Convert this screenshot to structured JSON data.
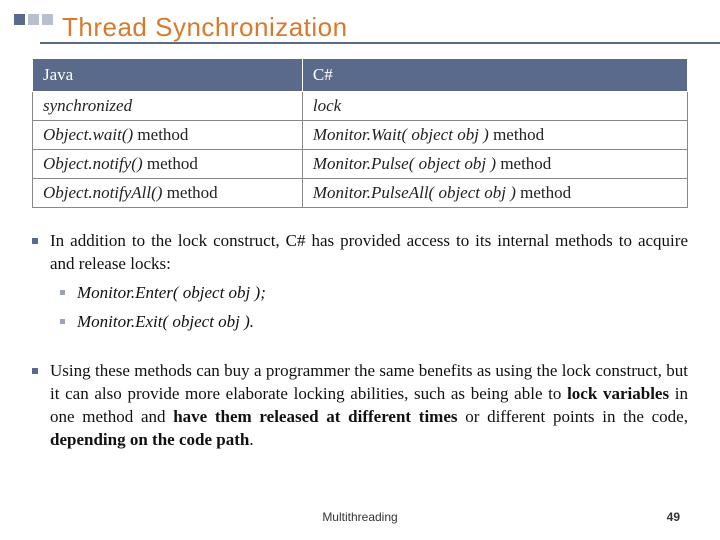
{
  "slide": {
    "title": "Thread Synchronization"
  },
  "table": {
    "headers": {
      "c1": "Java",
      "c2": "C#"
    },
    "rows": [
      {
        "c1_it": "synchronized",
        "c1_rest": "",
        "c2_it": "lock",
        "c2_rest": ""
      },
      {
        "c1_it": "Object.wait()",
        "c1_rest": " method",
        "c2_it": "Monitor.Wait( object obj )",
        "c2_rest": " method"
      },
      {
        "c1_it": "Object.notify()",
        "c1_rest": " method",
        "c2_it": "Monitor.Pulse( object obj )",
        "c2_rest": " method"
      },
      {
        "c1_it": "Object.notifyAll()",
        "c1_rest": " method",
        "c2_it": "Monitor.PulseAll( object obj )",
        "c2_rest": " method"
      }
    ]
  },
  "bullets": {
    "p1": "In addition to the lock construct, C# has provided access to its internal methods to acquire and release locks:",
    "s1": "Monitor.Enter( object obj );",
    "s2": "Monitor.Exit( object obj ).",
    "p2a": "Using these methods can buy a programmer the same benefits as using the lock construct, but it can also provide more elaborate locking abilities, such as being able to ",
    "p2b": "lock variables",
    "p2c": " in one method and ",
    "p2d": "have them released at different times",
    "p2e": " or different points in the code, ",
    "p2f": "depending on the code path",
    "p2g": "."
  },
  "footer": {
    "topic": "Multithreading",
    "page": "49"
  }
}
